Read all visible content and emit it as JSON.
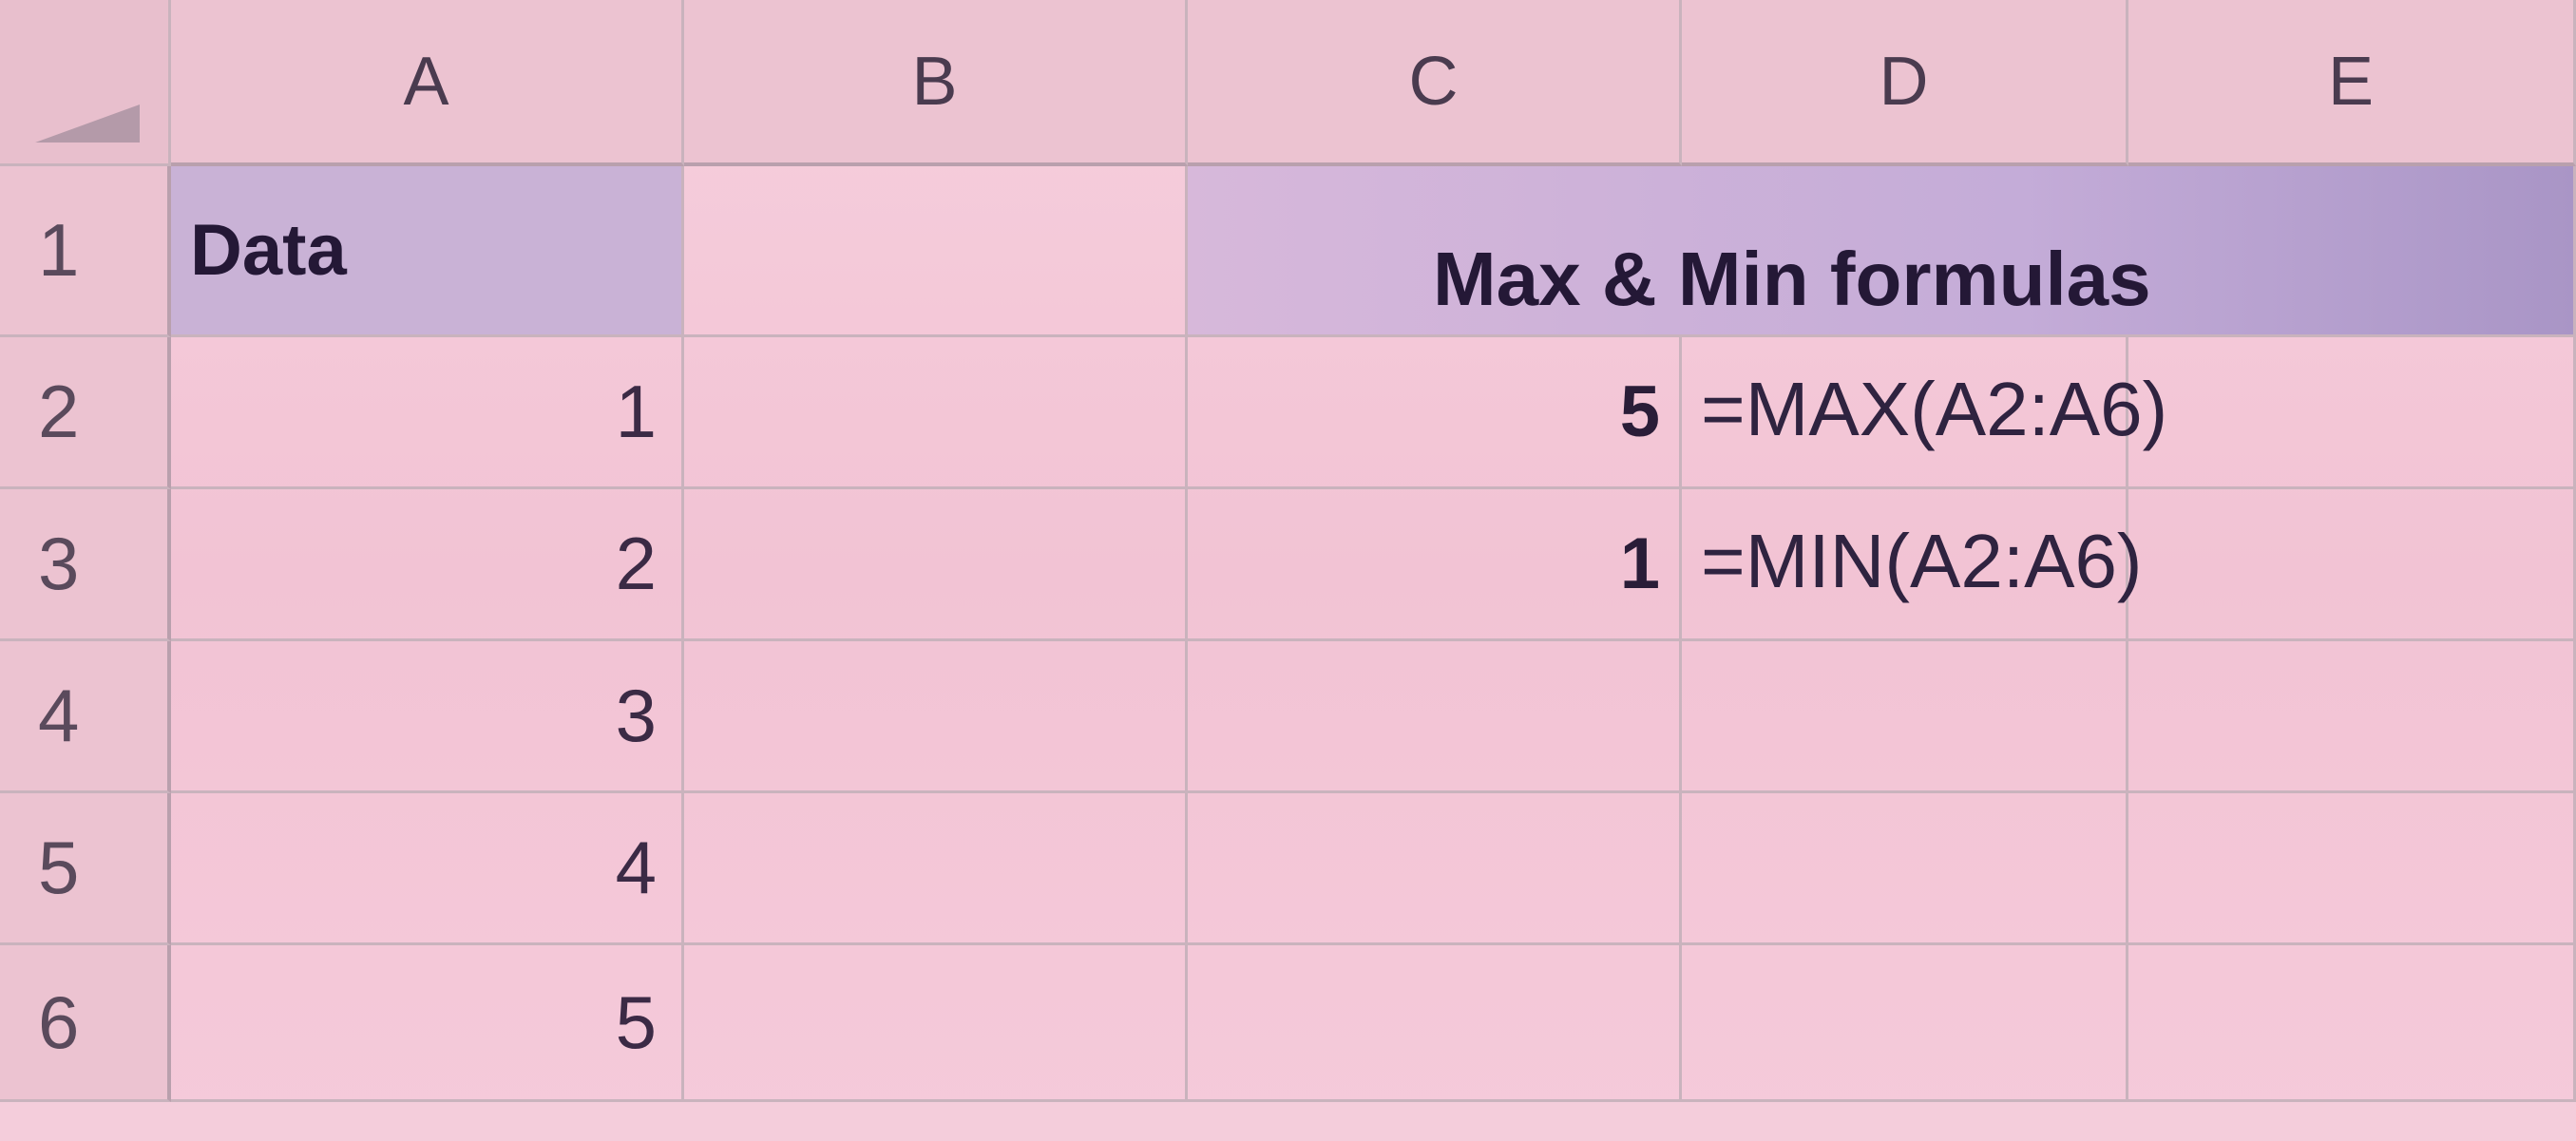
{
  "columns": [
    "A",
    "B",
    "C",
    "D",
    "E"
  ],
  "rows": [
    "1",
    "2",
    "3",
    "4",
    "5",
    "6"
  ],
  "cells": {
    "A1": "Data",
    "A2": "1",
    "A3": "2",
    "A4": "3",
    "A5": "4",
    "A6": "5",
    "C1": "Max & Min formulas",
    "C2": "5",
    "D2": "=MAX(A2:A6)",
    "C3": "1",
    "D3": "=MIN(A2:A6)"
  },
  "colors": {
    "background": "#f3c6d6",
    "header_fill": "#c9b2d6",
    "text": "#2a1d38"
  }
}
